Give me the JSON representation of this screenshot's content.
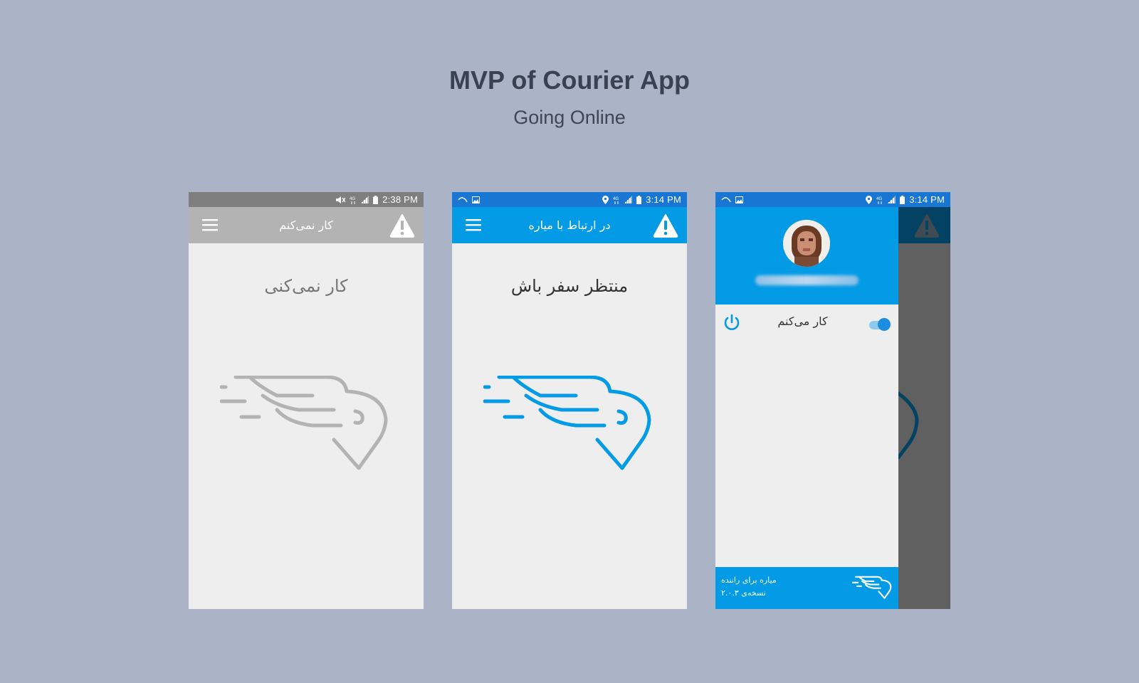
{
  "page": {
    "title": "MVP of Courier App",
    "subtitle": "Going Online"
  },
  "colors": {
    "background": "#aab4c6",
    "offline_bar": "#7f7f7f",
    "offline_appbar": "#b3b3b3",
    "online_status": "#1976d2",
    "online_appbar": "#039be5",
    "logo_gray": "#b3b3b3",
    "logo_blue": "#039be5"
  },
  "screens": [
    {
      "status_time": "2:38 PM",
      "appbar_title": "کار نمی‌کنم",
      "main_text": "کار نمی‌کنی",
      "icons": [
        "mute-icon",
        "network-4g-icon",
        "signal-icon",
        "battery-icon",
        "menu-icon",
        "warning-icon",
        "courier-logo"
      ]
    },
    {
      "status_time": "3:14 PM",
      "appbar_title": "در ارتباط با میاره",
      "main_text": "منتظر سفر باش",
      "icons": [
        "notification-icon",
        "image-icon",
        "location-icon",
        "network-4g-icon",
        "signal-icon",
        "battery-icon",
        "menu-icon",
        "warning-icon",
        "courier-logo"
      ]
    },
    {
      "status_time": "3:14 PM",
      "drawer": {
        "status_label": "کار می‌کنم",
        "toggle_on": true,
        "footer_line1": "میاره برای راننده",
        "footer_line2": "نسخه‌ی ۲.۰.۳"
      },
      "icons": [
        "notification-icon",
        "image-icon",
        "location-icon",
        "network-4g-icon",
        "signal-icon",
        "battery-icon",
        "avatar",
        "power-icon",
        "toggle",
        "courier-logo",
        "warning-icon"
      ]
    }
  ]
}
